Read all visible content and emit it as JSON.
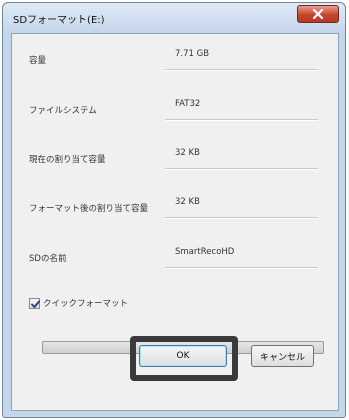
{
  "window": {
    "title": "SDフォーマット(E:)",
    "close_icon": "close-icon"
  },
  "rows": [
    {
      "label": "容量",
      "value": "7.71 GB"
    },
    {
      "label": "ファイルシステム",
      "value": "FAT32"
    },
    {
      "label": "現在の割り当て容量",
      "value": "32 KB"
    },
    {
      "label": "フォーマット後の割り当て容量",
      "value": "32 KB"
    },
    {
      "label": "SDの名前",
      "value": "SmartRecoHD"
    }
  ],
  "quick_format": {
    "label": "クイックフォーマット",
    "checked": true
  },
  "progress": {
    "fraction": 0.0
  },
  "buttons": {
    "ok": "OK",
    "cancel": "キャンセル"
  },
  "colors": {
    "close_button": "#c5452c",
    "highlight_frame": "#3a3a3a"
  }
}
